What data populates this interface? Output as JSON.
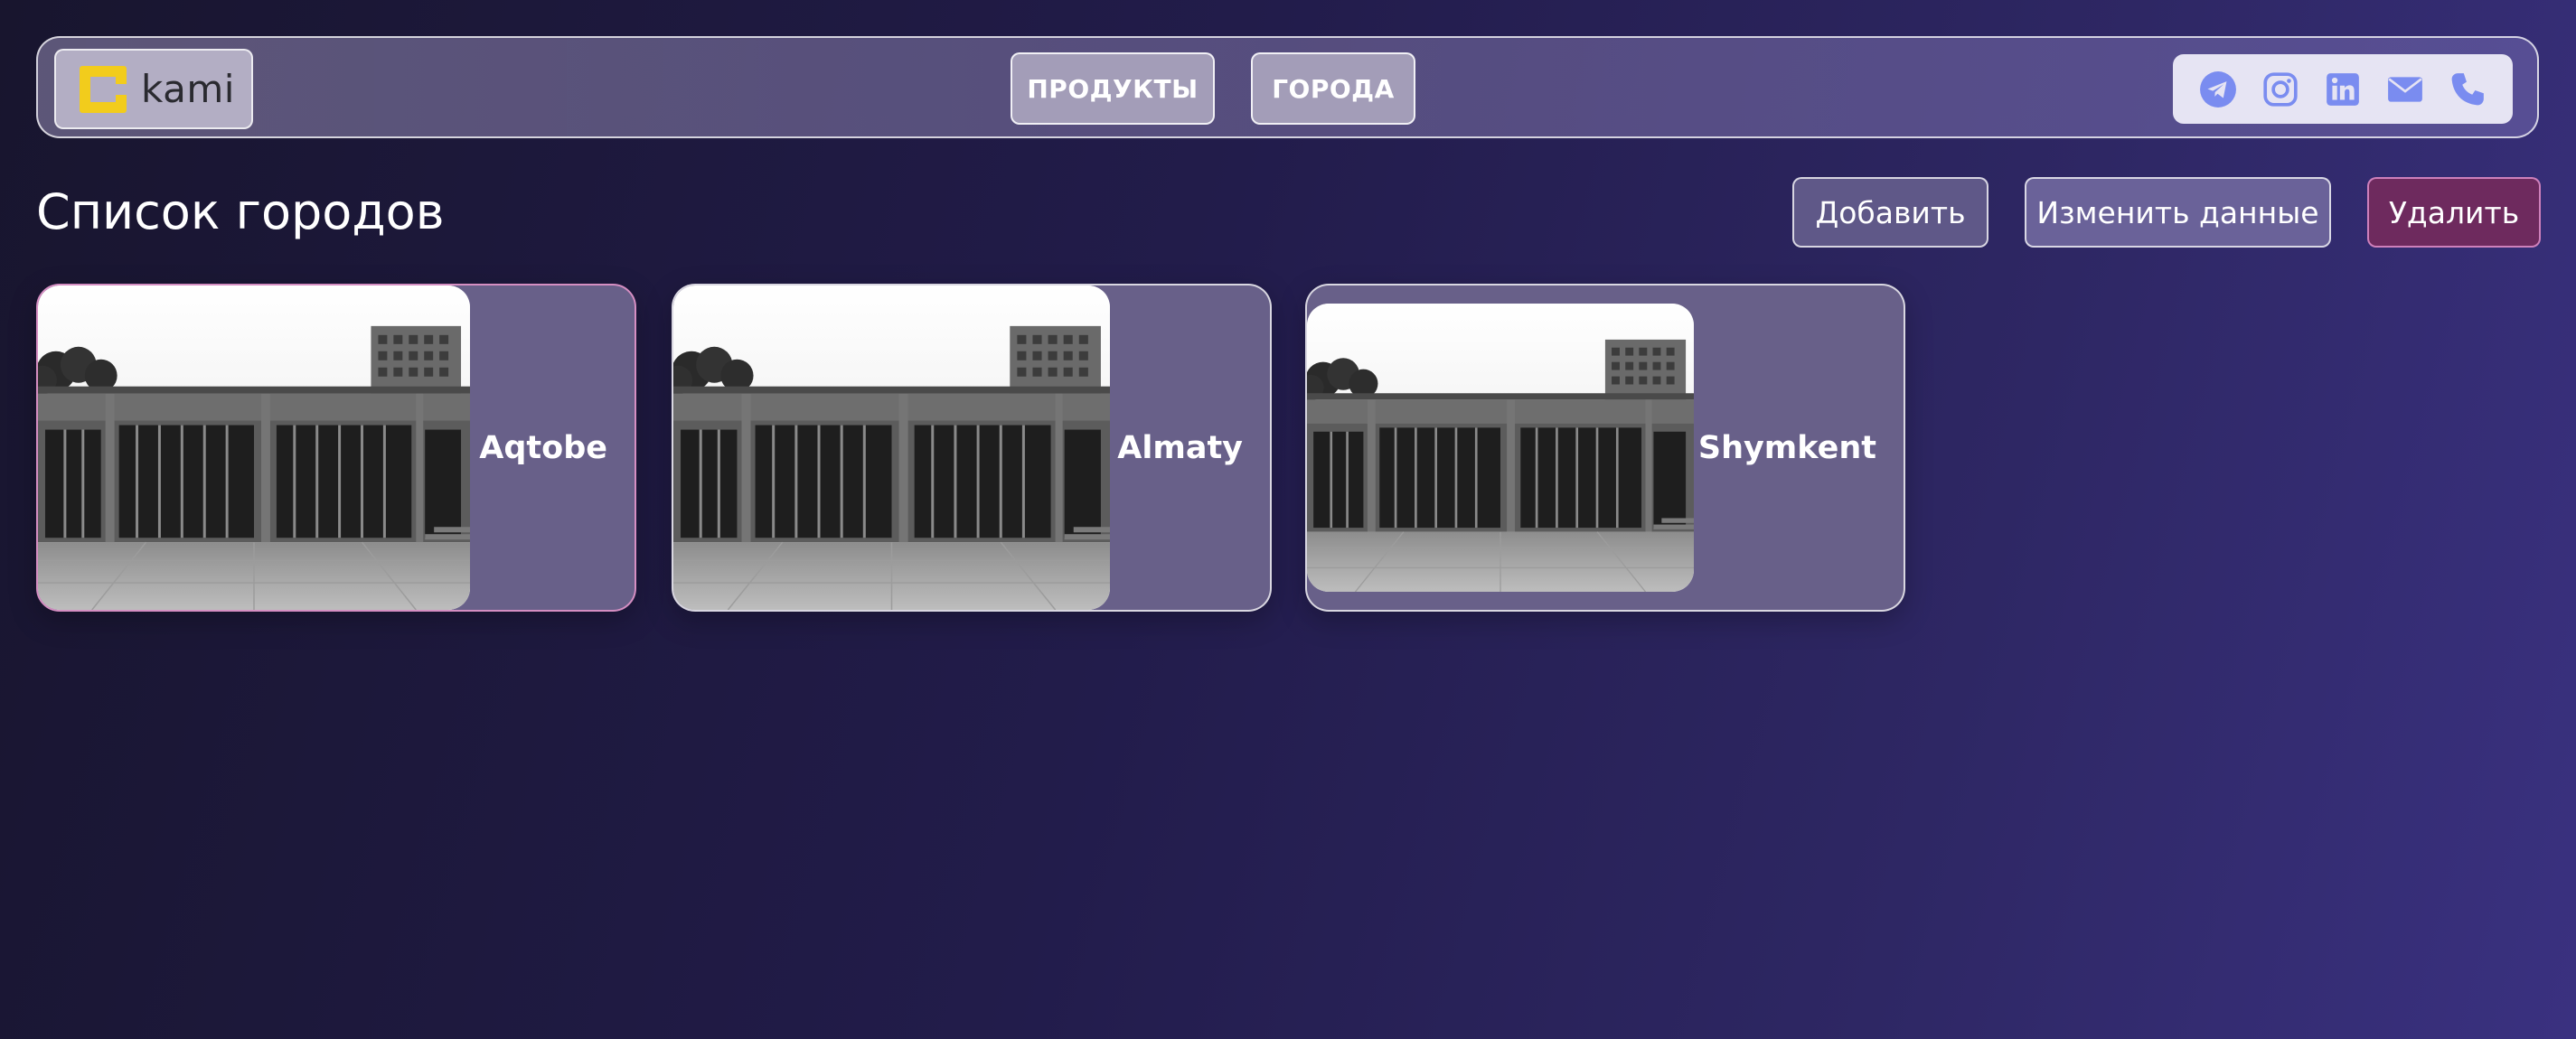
{
  "header": {
    "logo_text": "kami",
    "nav": [
      {
        "label": "ПРОДУКТЫ"
      },
      {
        "label": "ГОРОДА"
      }
    ],
    "social_icons": [
      "telegram-icon",
      "instagram-icon",
      "linkedin-icon",
      "mail-icon",
      "phone-icon"
    ],
    "icon_color": "#7a8cf0",
    "logo_color": "#f2cc1c"
  },
  "page": {
    "title": "Список городов",
    "actions": {
      "add": "Добавить",
      "edit": "Изменить данные",
      "delete": "Удалить"
    }
  },
  "cities": [
    {
      "name": "Aqtobe",
      "selected": true
    },
    {
      "name": "Almaty",
      "selected": false
    },
    {
      "name": "Shymkent",
      "selected": false
    }
  ]
}
